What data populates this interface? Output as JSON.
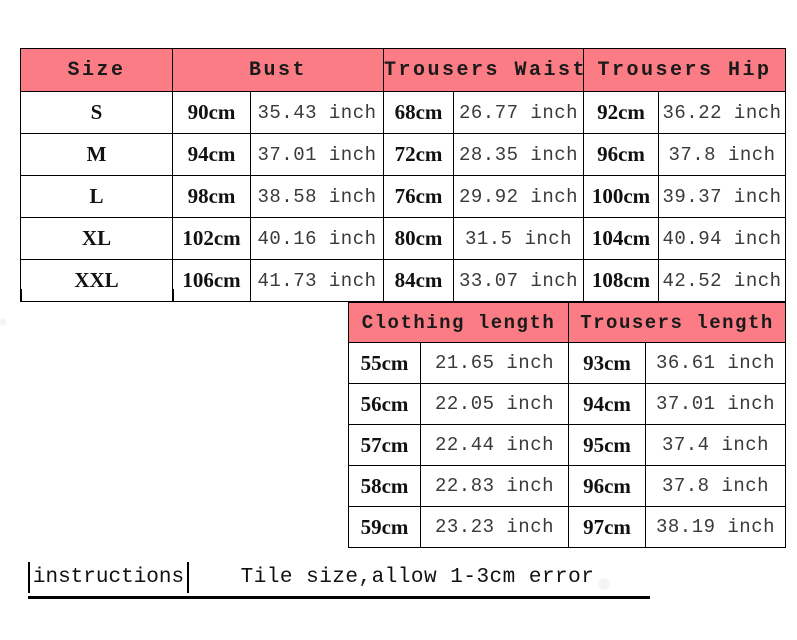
{
  "document": {
    "type": "garment-size-chart",
    "accent_color": "#fb7c84",
    "border_color": "#000000",
    "background_color": "#ffffff"
  },
  "size_table": {
    "headers": [
      "Size",
      "Bust",
      "Trousers Waist",
      "Trousers Hip"
    ],
    "rows": [
      {
        "size": "S",
        "bust_cm": "90cm",
        "bust_in": "35.43 inch",
        "waist_cm": "68cm",
        "waist_in": "26.77 inch",
        "hip_cm": "92cm",
        "hip_in": "36.22 inch"
      },
      {
        "size": "M",
        "bust_cm": "94cm",
        "bust_in": "37.01 inch",
        "waist_cm": "72cm",
        "waist_in": "28.35 inch",
        "hip_cm": "96cm",
        "hip_in": "37.8 inch"
      },
      {
        "size": "L",
        "bust_cm": "98cm",
        "bust_in": "38.58 inch",
        "waist_cm": "76cm",
        "waist_in": "29.92 inch",
        "hip_cm": "100cm",
        "hip_in": "39.37 inch"
      },
      {
        "size": "XL",
        "bust_cm": "102cm",
        "bust_in": "40.16 inch",
        "waist_cm": "80cm",
        "waist_in": "31.5 inch",
        "hip_cm": "104cm",
        "hip_in": "40.94 inch"
      },
      {
        "size": "XXL",
        "bust_cm": "106cm",
        "bust_in": "41.73 inch",
        "waist_cm": "84cm",
        "waist_in": "33.07 inch",
        "hip_cm": "108cm",
        "hip_in": "42.52 inch"
      }
    ]
  },
  "length_table": {
    "headers": [
      "Clothing length",
      "Trousers length"
    ],
    "rows": [
      {
        "clothing_cm": "55cm",
        "clothing_in": "21.65 inch",
        "trousers_cm": "93cm",
        "trousers_in": "36.61 inch"
      },
      {
        "clothing_cm": "56cm",
        "clothing_in": "22.05 inch",
        "trousers_cm": "94cm",
        "trousers_in": "37.01 inch"
      },
      {
        "clothing_cm": "57cm",
        "clothing_in": "22.44 inch",
        "trousers_cm": "95cm",
        "trousers_in": "37.4 inch"
      },
      {
        "clothing_cm": "58cm",
        "clothing_in": "22.83 inch",
        "trousers_cm": "96cm",
        "trousers_in": "37.8 inch"
      },
      {
        "clothing_cm": "59cm",
        "clothing_in": "23.23 inch",
        "trousers_cm": "97cm",
        "trousers_in": "38.19 inch"
      }
    ]
  },
  "instructions": {
    "label": "instructions",
    "text": "Tile size,allow 1-3cm error"
  }
}
